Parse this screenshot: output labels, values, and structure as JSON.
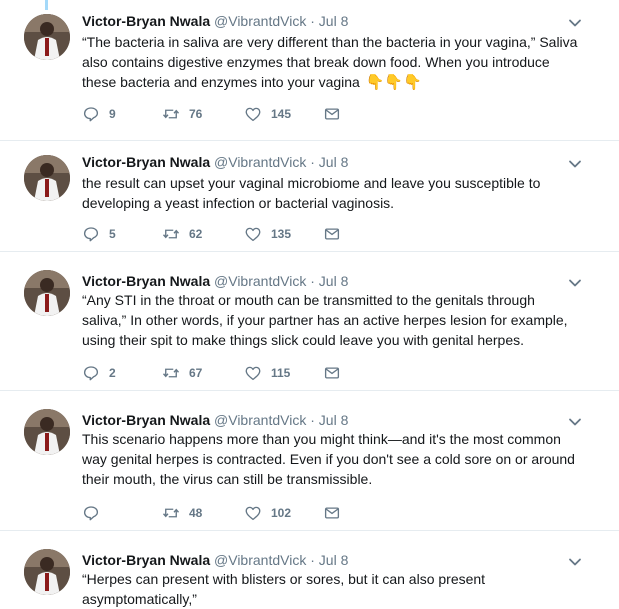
{
  "tweets": [
    {
      "name": "Victor-Bryan Nwala",
      "handle": "@VibrantdVick",
      "separator": "·",
      "date": "Jul 8",
      "text": "“The bacteria in saliva are very different than the bacteria in your vagina,” Saliva also contains digestive enzymes that break down food. When you introduce these bacteria and enzymes into your vagina",
      "emoji": "👇👇👇",
      "replies": "9",
      "retweets": "76",
      "likes": "145"
    },
    {
      "name": "Victor-Bryan Nwala",
      "handle": "@VibrantdVick",
      "separator": "·",
      "date": "Jul 8",
      "text": "the result can upset your vaginal microbiome and leave you susceptible to developing a yeast infection or bacterial vaginosis.",
      "emoji": "",
      "replies": "5",
      "retweets": "62",
      "likes": "135"
    },
    {
      "name": "Victor-Bryan Nwala",
      "handle": "@VibrantdVick",
      "separator": "·",
      "date": "Jul 8",
      "text": "“Any STI in the throat or mouth can be transmitted to the genitals through saliva,” In other words, if your partner has an active herpes lesion for example, using their spit to make things slick could leave you with genital herpes.",
      "emoji": "",
      "replies": "2",
      "retweets": "67",
      "likes": "115"
    },
    {
      "name": "Victor-Bryan Nwala",
      "handle": "@VibrantdVick",
      "separator": "·",
      "date": "Jul 8",
      "text": "This scenario happens more than you might think—and it's the most common way genital herpes is contracted. Even if you don't see a cold sore on or around their mouth, the virus can still be transmissible.",
      "emoji": "",
      "replies": "",
      "retweets": "48",
      "likes": "102"
    },
    {
      "name": "Victor-Bryan Nwala",
      "handle": "@VibrantdVick",
      "separator": "·",
      "date": "Jul 8",
      "text": "“Herpes can present with blisters or sores, but it can also present asymptomatically,”",
      "emoji": "",
      "replies": "",
      "retweets": "",
      "likes": ""
    }
  ],
  "colors": {
    "text": "#14171a",
    "secondary": "#657786",
    "border": "#e6ecf0",
    "thread": "#a4d9f9"
  },
  "icons": [
    "reply-icon",
    "retweet-icon",
    "like-icon",
    "direct-message-icon",
    "caret-down-icon"
  ]
}
